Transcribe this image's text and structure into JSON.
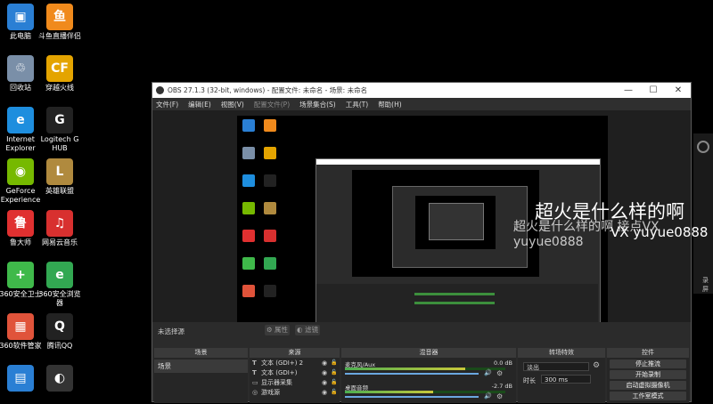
{
  "desktop": {
    "icons": [
      {
        "label": "此电脑",
        "name": "this-pc-icon",
        "glyph": "▣",
        "color": "#2a7fd4"
      },
      {
        "label": "斗鱼直播伴侣",
        "name": "douyu-icon",
        "glyph": "鱼",
        "color": "#f08a1c"
      },
      {
        "label": "回收站",
        "name": "recycle-bin-icon",
        "glyph": "♲",
        "color": "#7a8fa8"
      },
      {
        "label": "穿越火线",
        "name": "crossfire-icon",
        "glyph": "CF",
        "color": "#e4a400"
      },
      {
        "label": "Internet Explorer",
        "name": "ie-icon",
        "glyph": "e",
        "color": "#1e8ede"
      },
      {
        "label": "Logitech G HUB",
        "name": "logitech-icon",
        "glyph": "G",
        "color": "#222"
      },
      {
        "label": "GeForce Experience",
        "name": "geforce-icon",
        "glyph": "◉",
        "color": "#76b900"
      },
      {
        "label": "英雄联盟",
        "name": "lol-icon",
        "glyph": "L",
        "color": "#b08a3e"
      },
      {
        "label": "鲁大师",
        "name": "ludashi-icon",
        "glyph": "鲁",
        "color": "#e03030"
      },
      {
        "label": "网易云音乐",
        "name": "netease-music-icon",
        "glyph": "♫",
        "color": "#d8302f"
      },
      {
        "label": "360安全卫士",
        "name": "360-security-icon",
        "glyph": "+",
        "color": "#3fb94a"
      },
      {
        "label": "360安全浏览器",
        "name": "360-browser-icon",
        "glyph": "e",
        "color": "#32a852"
      },
      {
        "label": "360软件管家",
        "name": "360-software-icon",
        "glyph": "▦",
        "color": "#e0533a"
      },
      {
        "label": "腾讯QQ",
        "name": "qq-icon",
        "glyph": "Q",
        "color": "#222"
      },
      {
        "label": "",
        "name": "app-icon",
        "glyph": "▤",
        "color": "#2a7fd4"
      },
      {
        "label": "",
        "name": "obs-icon",
        "glyph": "◐",
        "color": "#333"
      }
    ]
  },
  "obs": {
    "title": "OBS 27.1.3 (32-bit, windows) - 配置文件: 未命名 - 场景: 未命名",
    "window_controls": {
      "min": "—",
      "max": "☐",
      "close": "✕"
    },
    "menu": [
      "文件(F)",
      "编辑(E)",
      "视图(V)",
      "配置文件(P)",
      "场景集合(S)",
      "工具(T)",
      "帮助(H)"
    ],
    "no_source": "未选择源",
    "props_btn": "属性",
    "filters_btn": "滤镜",
    "panels": {
      "scenes": "场景",
      "sources": "来源",
      "mixer": "混音器",
      "transitions": "转场特效",
      "controls": "控件"
    },
    "scenes": [
      "场景"
    ],
    "sources": [
      {
        "label": "文本 (GDI+) 2",
        "type": "T"
      },
      {
        "label": "文本 (GDI+)",
        "type": "T"
      },
      {
        "label": "显示器采集",
        "type": "▭"
      },
      {
        "label": "游戏源",
        "type": "◎"
      }
    ],
    "mixer": [
      {
        "name": "麦克风/Aux",
        "db": "0.0 dB",
        "level": 0.75
      },
      {
        "name": "桌面音频",
        "db": "-2.7 dB",
        "level": 0.55
      }
    ],
    "transitions": {
      "select": "淡出",
      "duration_label": "时长",
      "duration": "300 ms"
    },
    "controls": [
      "停止推流",
      "开始录制",
      "启动虚拟摄像机",
      "工作室模式"
    ]
  },
  "overlay": {
    "line1": "超火是什么样的啊",
    "line2": "VX yuyue0888",
    "ghost": "超火是什么样的啊 接点VX yuyue0888"
  },
  "right_side": {
    "label": "录屏"
  }
}
